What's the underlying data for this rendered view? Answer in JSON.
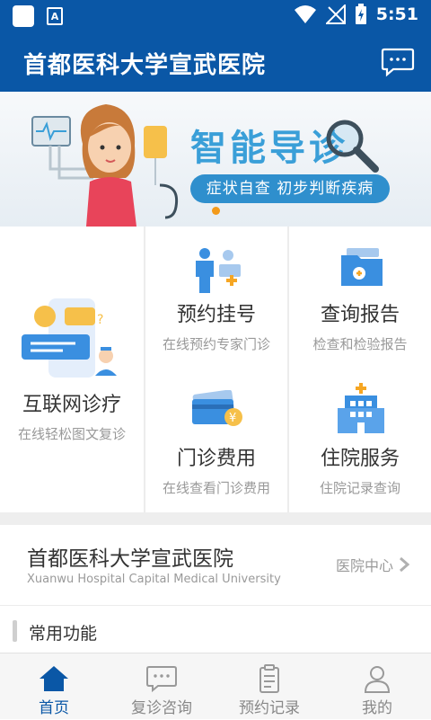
{
  "status_bar": {
    "time": "5:51",
    "a_badge": "A"
  },
  "header": {
    "title": "首都医科大学宣武医院",
    "message_icon": "chat-icon"
  },
  "banner": {
    "title": "智能导诊",
    "subtitle": "症状自查 初步判断疾病"
  },
  "services": [
    {
      "title": "互联网诊疗",
      "subtitle": "在线轻松图文复诊"
    },
    {
      "title": "预约挂号",
      "subtitle": "在线预约专家门诊"
    },
    {
      "title": "查询报告",
      "subtitle": "检查和检验报告"
    },
    {
      "title": "门诊费用",
      "subtitle": "在线查看门诊费用"
    },
    {
      "title": "住院服务",
      "subtitle": "住院记录查询"
    }
  ],
  "hospital": {
    "name": "首都医科大学宣武医院",
    "english": "Xuanwu Hospital Capital Medical University",
    "link": "医院中心"
  },
  "common": {
    "title": "常用功能"
  },
  "tabs": [
    {
      "label": "首页",
      "icon": "home-icon",
      "active": true
    },
    {
      "label": "复诊咨询",
      "icon": "chat-icon",
      "active": false
    },
    {
      "label": "预约记录",
      "icon": "clipboard-icon",
      "active": false
    },
    {
      "label": "我的",
      "icon": "user-icon",
      "active": false
    }
  ],
  "colors": {
    "primary": "#0a57a6",
    "accent": "#3a9fd8",
    "dot": "#f39a1a"
  }
}
